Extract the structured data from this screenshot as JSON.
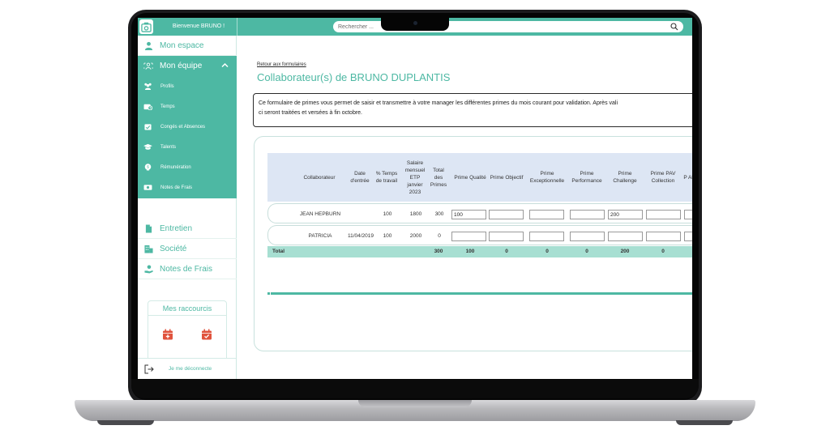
{
  "topbar": {
    "welcome": "Bienvenue BRUNO !",
    "search_placeholder": "Rechercher ..."
  },
  "sidebar": {
    "items": [
      {
        "label": "Mon espace",
        "icon": "user-icon"
      },
      {
        "label": "Mon équipe",
        "icon": "team-icon",
        "active": true
      }
    ],
    "submenu": [
      {
        "label": "Profils",
        "icon": "profiles-icon"
      },
      {
        "label": "Temps",
        "icon": "time-icon"
      },
      {
        "label": "Congés et Absences",
        "icon": "calendar-check-icon"
      },
      {
        "label": "Talents",
        "icon": "graduation-cap-icon"
      },
      {
        "label": "Rémunération",
        "icon": "money-icon"
      },
      {
        "label": "Notes de Frais",
        "icon": "receipt-icon"
      }
    ],
    "items_after": [
      {
        "label": "Entretien",
        "icon": "document-icon"
      },
      {
        "label": "Société",
        "icon": "building-icon"
      },
      {
        "label": "Notes de Frais",
        "icon": "hand-money-icon"
      }
    ],
    "shortcuts_title": "Mes raccourcis",
    "logout": "Je me déconnecte"
  },
  "main": {
    "back_link": "Retour aux formulaires",
    "title": "Collaborateur(s) de BRUNO DUPLANTIS",
    "notice_line1": "Ce formulaire de primes vous permet de saisir et transmettre à votre manager les différentes primes du mois courant pour validation. Après vali",
    "notice_line2": "ci seront traitées et versées à fin octobre."
  },
  "table": {
    "headers": {
      "collaborateur": "Collaborateur",
      "date": "Date d'entrée",
      "temps": "% Temps de travail",
      "salaire": "Salaire mensuel ETP janvier 2023",
      "total": "Total des Primes",
      "qualite": "Prime Qualité",
      "objectif": "Prime Objectif",
      "exceptionnelle": "Prime Exceptionnelle",
      "performance": "Prime Performance",
      "challenge": "Prime Challenge",
      "pav": "Prime PAV Collection",
      "abo": "P Abo"
    },
    "rows": [
      {
        "name": "JEAN HEPBURN",
        "date": "",
        "temps": "100",
        "salaire": "1800",
        "total": "300",
        "qualite": "100",
        "objectif": "",
        "exceptionnelle": "",
        "performance": "",
        "challenge": "200",
        "pav": ""
      },
      {
        "name": "PATRICIA",
        "date": "11/04/2019",
        "temps": "100",
        "salaire": "2000",
        "total": "0",
        "qualite": "",
        "objectif": "",
        "exceptionnelle": "",
        "performance": "",
        "challenge": "",
        "pav": ""
      }
    ],
    "totals": {
      "label": "Total",
      "total": "300",
      "qualite": "100",
      "objectif": "0",
      "exceptionnelle": "0",
      "performance": "0",
      "challenge": "200",
      "pav": "0"
    }
  },
  "colors": {
    "accent": "#4db8a3",
    "header_bg": "#dde6f4",
    "total_bg": "#a7dfd2",
    "shortcut_red": "#e0533d"
  }
}
